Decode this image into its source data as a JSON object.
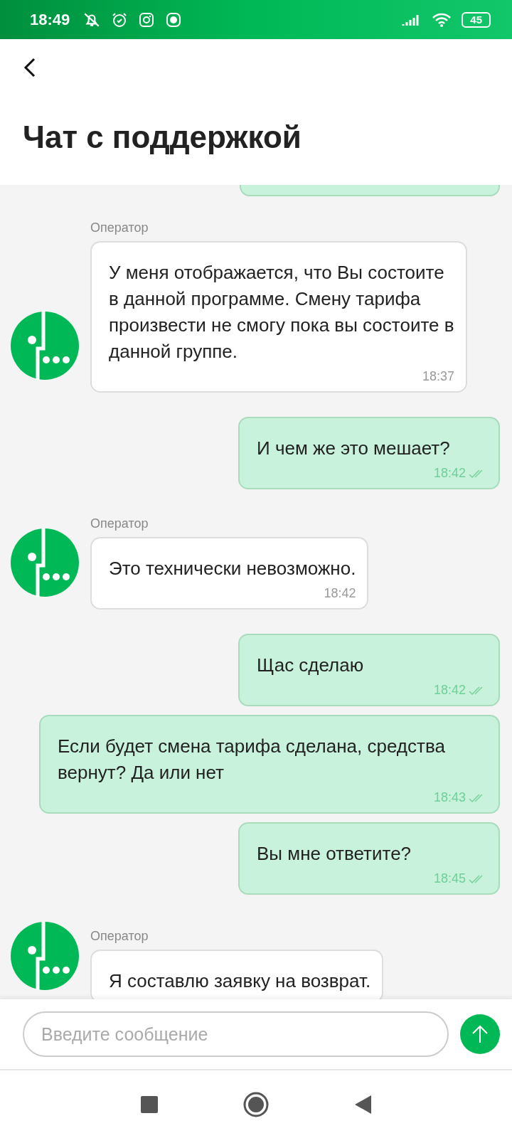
{
  "status_bar": {
    "time": "18:49",
    "battery": "45"
  },
  "header": {
    "title": "Чат с поддержкой"
  },
  "messages": [
    {
      "kind": "incoming",
      "sender": "Оператор",
      "text": "У меня отображается, что Вы состоите в данной программе. Смену тарифа произвести не смогу пока вы состоите в данной группе.",
      "time": "18:37"
    },
    {
      "kind": "outgoing",
      "text": "И чем же это мешает?",
      "time": "18:42"
    },
    {
      "kind": "incoming",
      "sender": "Оператор",
      "text": "Это технически невозможно.",
      "time": "18:42"
    },
    {
      "kind": "outgoing",
      "text": "Щас сделаю",
      "time": "18:42"
    },
    {
      "kind": "outgoing",
      "text": "Если будет смена тарифа сделана, средства вернут? Да или нет",
      "time": "18:43"
    },
    {
      "kind": "outgoing",
      "text": "Вы мне ответите?",
      "time": "18:45"
    },
    {
      "kind": "incoming",
      "sender": "Оператор",
      "text": "Я составлю заявку на возврат."
    }
  ],
  "composer": {
    "placeholder": "Введите сообщение"
  }
}
